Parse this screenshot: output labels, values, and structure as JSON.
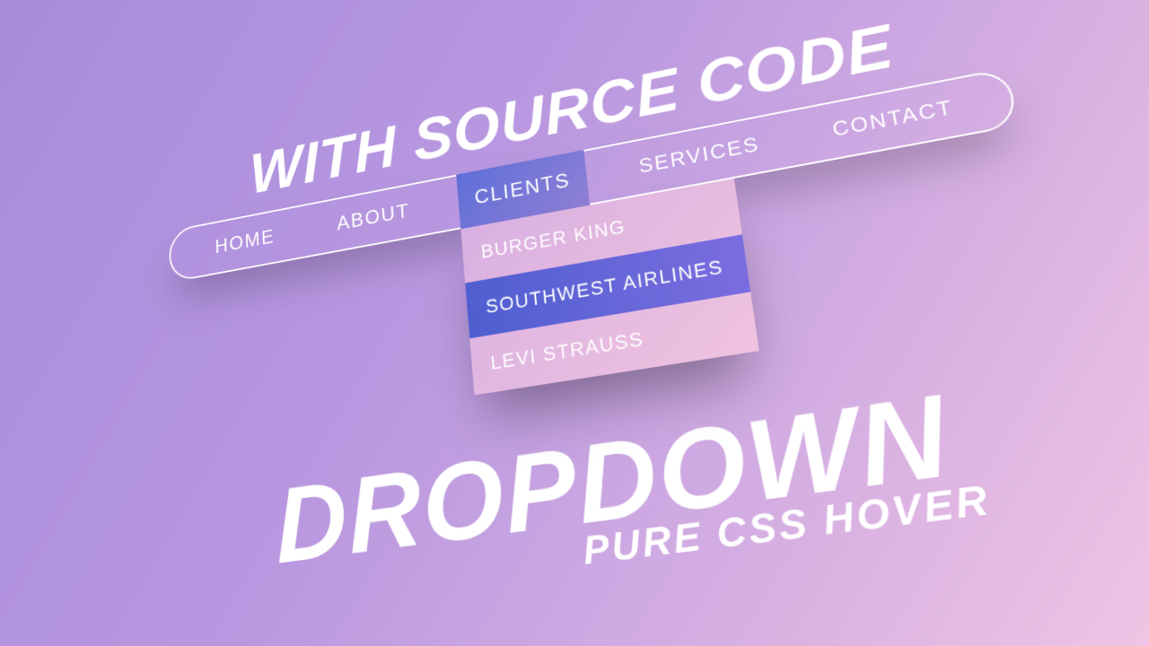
{
  "title_top": "WITH SOURCE CODE",
  "nav": {
    "items": [
      {
        "label": "HOME",
        "active": false
      },
      {
        "label": "ABOUT",
        "active": false
      },
      {
        "label": "CLIENTS",
        "active": true
      },
      {
        "label": "SERVICES",
        "active": false
      },
      {
        "label": "CONTACT",
        "active": false
      }
    ]
  },
  "dropdown": {
    "items": [
      {
        "label": "BURGER KING",
        "hover": false
      },
      {
        "label": "SOUTHWEST AIRLINES",
        "hover": true
      },
      {
        "label": "LEVI STRAUSS",
        "hover": false
      }
    ]
  },
  "title_bottom": "DROPDOWN",
  "subtitle_bottom": "PURE CSS HOVER"
}
